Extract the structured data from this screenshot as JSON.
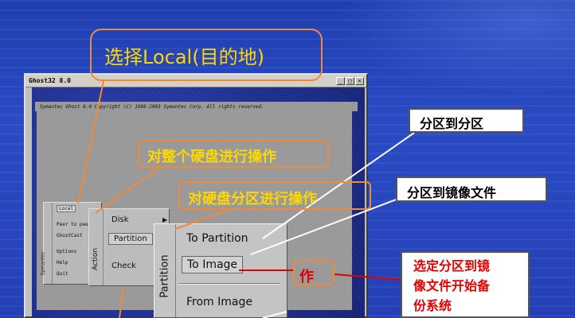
{
  "window": {
    "title": "Ghost32 8.0",
    "controls": [
      "_",
      "□",
      "×"
    ],
    "copyright": "Symantec Ghost 8.0    Copyright (C) 1998-2003 Symantec Corp. All rights reserved."
  },
  "main_menu": {
    "side_label": "Symantec",
    "items": [
      "Local",
      "Peer to peer",
      "GhostCast",
      "Options",
      "Help",
      "Quit"
    ],
    "selected": "Local"
  },
  "action_menu": {
    "side_label": "Action",
    "items": [
      "Disk",
      "Partition",
      "Check"
    ],
    "selected": "Partition"
  },
  "partition_menu": {
    "side_label": "Partition",
    "items": [
      "To Partition",
      "To Image",
      "From Image"
    ],
    "selected": "To Image"
  },
  "callouts": {
    "local": "选择Local(目的地)",
    "whole_disk": "对整个硬盘进行操作",
    "partition": "对硬盘分区进行操作",
    "partition_stub": "作",
    "p2p": "分区到分区",
    "p2i": "分区到镜像文件",
    "backup": [
      "选定分区到镜",
      "像文件开始备",
      "份系统"
    ]
  },
  "colors": {
    "background": "#2540b6",
    "callout_border": "#f08a3a",
    "callout_text": "#ffd700",
    "red_text": "#e00000"
  }
}
